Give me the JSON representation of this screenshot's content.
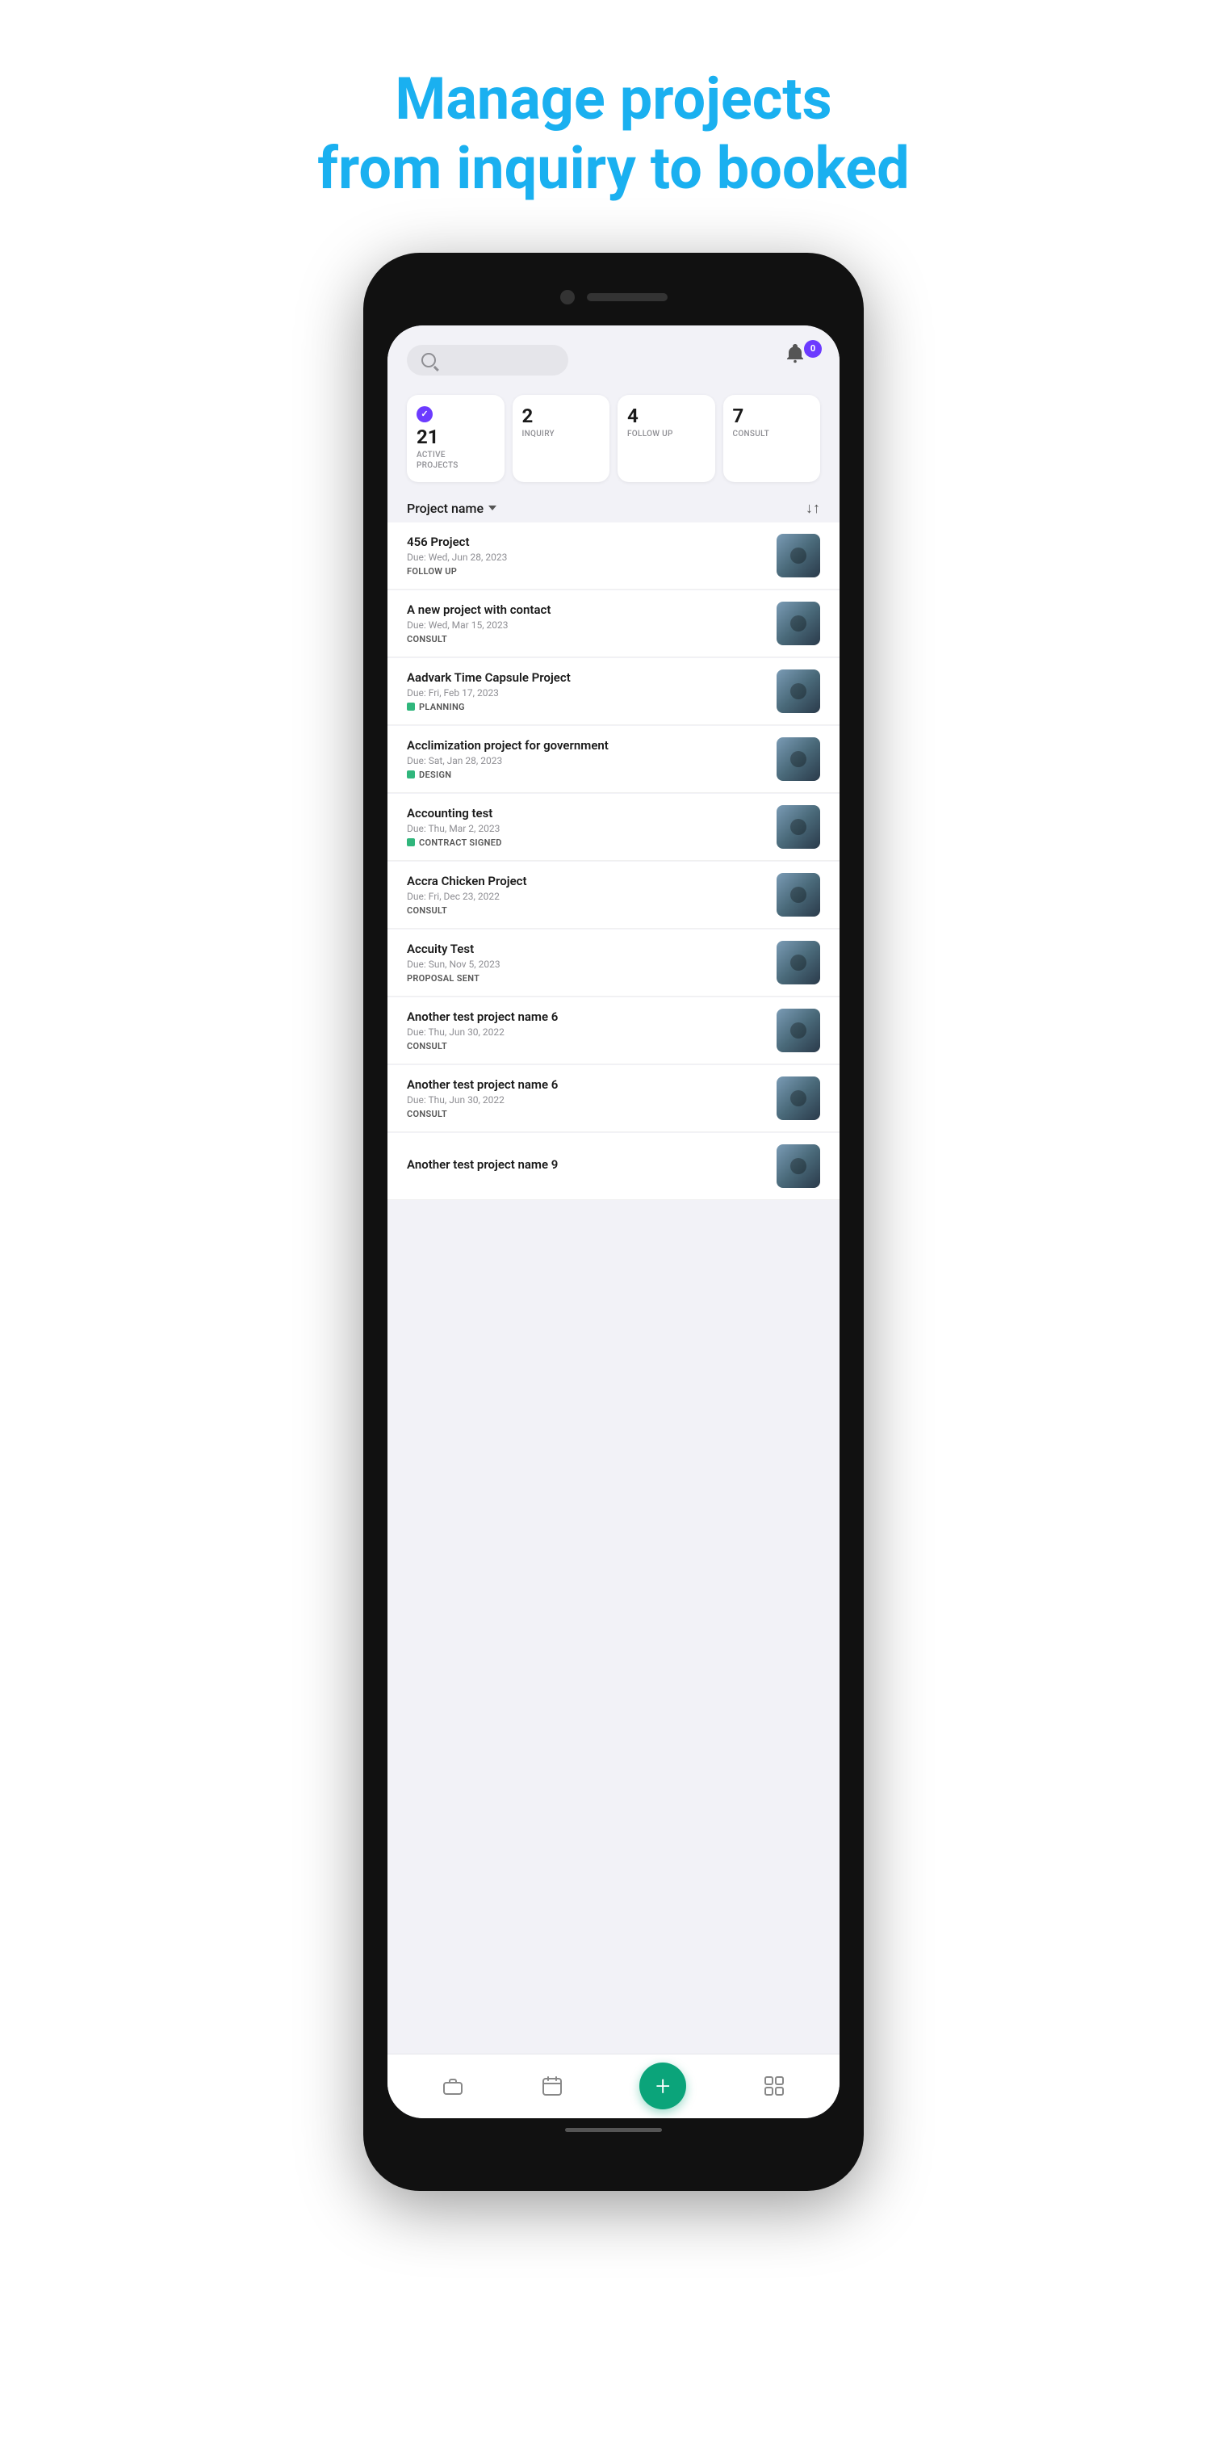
{
  "header": {
    "line1": "Manage projects",
    "line2": "from inquiry to booked"
  },
  "app": {
    "search": {
      "placeholder": ""
    },
    "notification_count": "0",
    "stats": [
      {
        "number": "21",
        "label": "ACTIVE\nPROJECTS",
        "show_check": true
      },
      {
        "number": "2",
        "label": "INQUIRY"
      },
      {
        "number": "4",
        "label": "FOLLOW UP"
      },
      {
        "number": "7",
        "label": "CONSULT"
      }
    ],
    "filter_label": "Project name",
    "sort_label": "↓↑",
    "projects": [
      {
        "name": "456 Project",
        "due": "Due: Wed, Jun 28, 2023",
        "status": "FOLLOW UP",
        "status_type": "plain"
      },
      {
        "name": "A new project with contact",
        "due": "Due: Wed, Mar 15, 2023",
        "status": "CONSULT",
        "status_type": "plain"
      },
      {
        "name": "Aadvark Time Capsule Project",
        "due": "Due: Fri, Feb 17, 2023",
        "status": "PLANNING",
        "status_type": "dot",
        "dot_class": "planning"
      },
      {
        "name": "Acclimization project for government",
        "due": "Due: Sat, Jan 28, 2023",
        "status": "DESIGN",
        "status_type": "dot",
        "dot_class": "design"
      },
      {
        "name": "Accounting test",
        "due": "Due: Thu, Mar 2, 2023",
        "status": "CONTRACT SIGNED",
        "status_type": "dot",
        "dot_class": "contract"
      },
      {
        "name": "Accra Chicken Project",
        "due": "Due: Fri, Dec 23, 2022",
        "status": "CONSULT",
        "status_type": "plain"
      },
      {
        "name": "Accuity Test",
        "due": "Due: Sun, Nov 5, 2023",
        "status": "PROPOSAL SENT",
        "status_type": "plain"
      },
      {
        "name": "Another test project name 6",
        "due": "Due: Thu, Jun 30, 2022",
        "status": "CONSULT",
        "status_type": "plain"
      },
      {
        "name": "Another test project name 6",
        "due": "Due: Thu, Jun 30, 2022",
        "status": "CONSULT",
        "status_type": "plain"
      },
      {
        "name": "Another test project name 9",
        "due": "",
        "status": "",
        "status_type": "plain"
      }
    ],
    "bottom_nav": [
      {
        "icon": "briefcase",
        "label": ""
      },
      {
        "icon": "calendar",
        "label": ""
      },
      {
        "icon": "add",
        "label": ""
      },
      {
        "icon": "grid",
        "label": ""
      }
    ]
  }
}
